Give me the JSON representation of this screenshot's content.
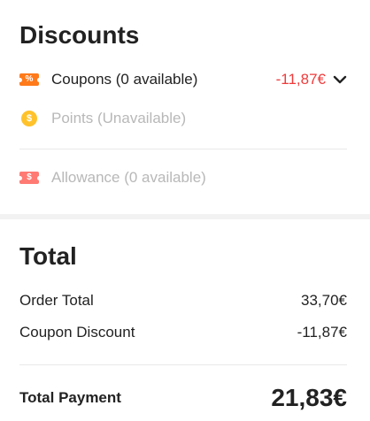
{
  "discounts": {
    "title": "Discounts",
    "coupons": {
      "label": "Coupons (0 available)",
      "amount": "-11,87€",
      "icon": "coupon-percent-icon",
      "icon_glyph": "%"
    },
    "points": {
      "label": "Points (Unavailable)",
      "icon": "points-coin-icon",
      "icon_glyph": "$"
    },
    "allowance": {
      "label": "Allowance (0 available)",
      "icon": "allowance-ticket-icon",
      "icon_glyph": "$"
    }
  },
  "total": {
    "title": "Total",
    "order_total_label": "Order Total",
    "order_total_value": "33,70€",
    "coupon_discount_label": "Coupon Discount",
    "coupon_discount_value": "-11,87€",
    "payment_label": "Total Payment",
    "payment_value": "21,83€"
  },
  "colors": {
    "accent_red": "#ef3b3b",
    "coupon_icon": "#ff7a1a",
    "allowance_icon": "#ff7a73",
    "points_icon": "#ffc22a",
    "muted_text": "#b8b8b8"
  }
}
